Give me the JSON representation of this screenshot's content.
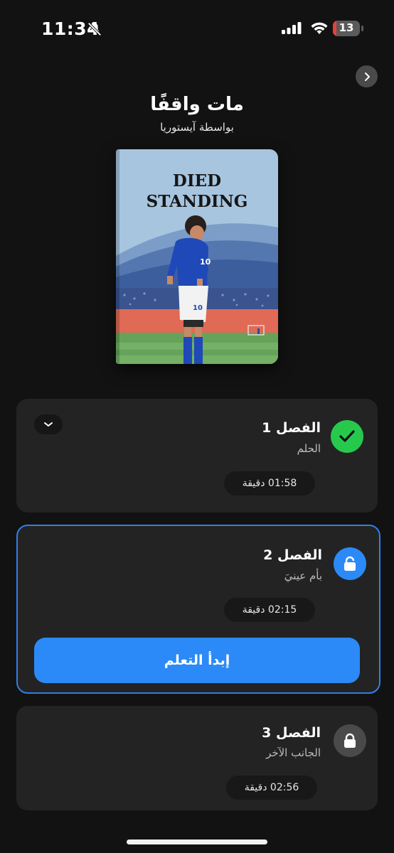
{
  "status_bar": {
    "time": "11:34",
    "battery": "13",
    "battery_level": 0.13,
    "battery_color": "#e5413a"
  },
  "book": {
    "title": "مات واقفًا",
    "author": "بواسطة آيستوريا",
    "cover_title_line1": "DIED",
    "cover_title_line2": "STANDING",
    "cover_player_number": "10"
  },
  "chapters": [
    {
      "title": "الفصل 1",
      "subtitle": "الحلم",
      "duration": "01:58 دقيقة",
      "status": "completed",
      "icon": "check-icon"
    },
    {
      "title": "الفصل 2",
      "subtitle": "بأم عينيَ",
      "duration": "02:15 دقيقة",
      "status": "current",
      "icon": "lock-open-icon",
      "action_label": "إبدأ التعلم"
    },
    {
      "title": "الفصل 3",
      "subtitle": "الجانب الآخر",
      "duration": "02:56 دقيقة",
      "status": "locked",
      "icon": "lock-icon"
    }
  ],
  "colors": {
    "accent": "#2b8af7",
    "success": "#27c94d",
    "background": "#121212",
    "card": "#232323"
  }
}
